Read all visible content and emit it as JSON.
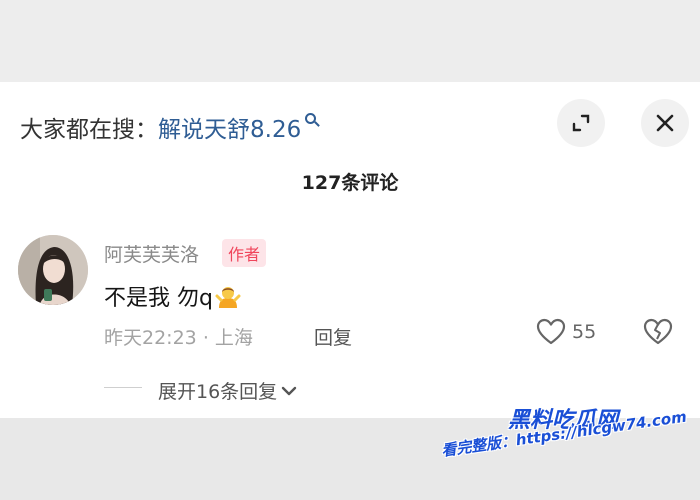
{
  "search_hint": {
    "prefix": "大家都在搜：",
    "query": "解说天舒8.26"
  },
  "comment_count": "127条评论",
  "comment": {
    "author": "阿芙芙芙洛",
    "badge": "作者",
    "text": "不是我 勿q",
    "emoji": "person-gesturing-shrug-emoji",
    "time": "昨天22:23",
    "separator": "·",
    "location": "上海",
    "reply_label": "回复",
    "likes": "55",
    "expand_replies": "展开16条回复"
  },
  "watermark": {
    "logo": "黑料吃瓜网",
    "url": "看完整版：https://hlcgw74.com"
  },
  "colors": {
    "query_link": "#2f5d94",
    "badge_text": "#f0455b",
    "badge_bg": "#fde4e8",
    "watermark": "#1a4fd6"
  }
}
